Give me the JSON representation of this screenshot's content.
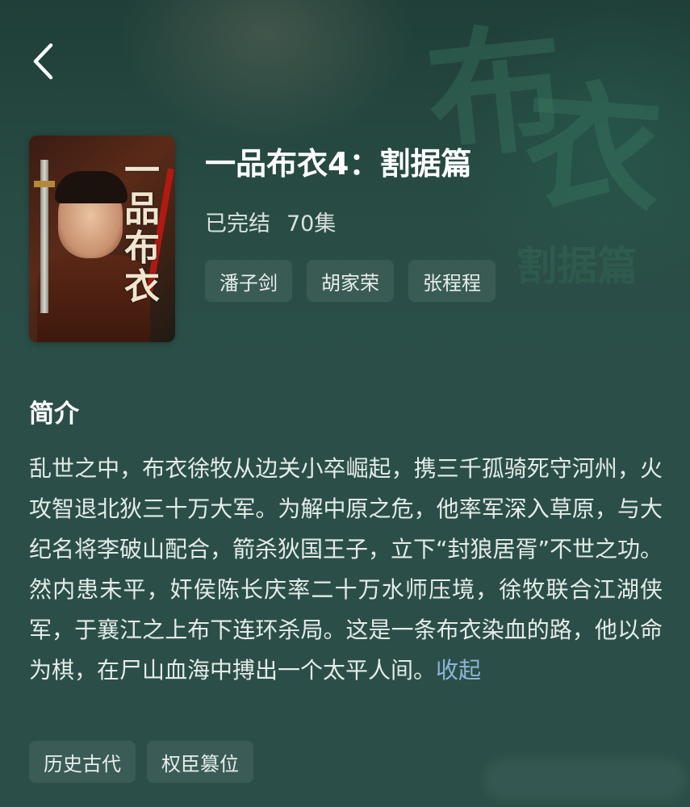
{
  "nav": {
    "back_icon": "chevron-left-icon"
  },
  "background": {
    "calligraphy_chars": [
      "布",
      "衣"
    ],
    "calligraphy_subtitle": "割据篇"
  },
  "poster": {
    "title_chars": [
      "一",
      "品",
      "布",
      "衣"
    ],
    "top_text": "",
    "bottom_text": ""
  },
  "show": {
    "title": "一品布衣4：割据篇",
    "status": "已完结",
    "episodes": "70集"
  },
  "cast": [
    "潘子剑",
    "胡家荣",
    "张程程"
  ],
  "synopsis": {
    "heading": "简介",
    "text": "乱世之中，布衣徐牧从边关小卒崛起，携三千孤骑死守河州，火攻智退北狄三十万大军。为解中原之危，他率军深入草原，与大纪名将李破山配合，箭杀狄国王子，立下“封狼居胥”不世之功。然内患未平，奸侯陈长庆率二十万水师压境，徐牧联合江湖侠军，于襄江之上布下连环杀局。这是一条布衣染血的路，他以命为棋，在尸山血海中搏出一个太平人间。",
    "collapse_label": "收起"
  },
  "genres": [
    "历史古代",
    "权臣篡位"
  ],
  "colors": {
    "background": "#2b4f48",
    "tag_bg": "rgba(255,255,255,0.08)",
    "link": "#8fb4d6",
    "text_primary": "#ffffff",
    "text_secondary": "#d9e1de"
  }
}
